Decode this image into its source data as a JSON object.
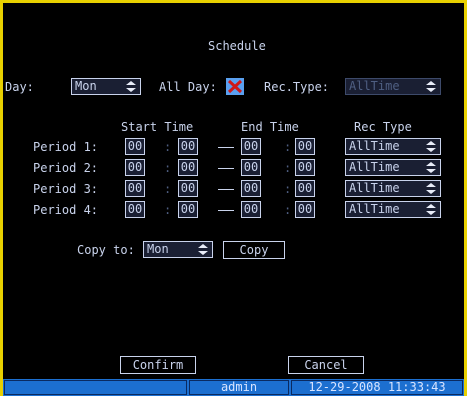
{
  "title": "Schedule",
  "day": {
    "label": "Day:",
    "value": "Mon"
  },
  "all_day": {
    "label": "All Day:",
    "checked": true
  },
  "rec_type": {
    "label": "Rec.Type:",
    "value": "AllTime"
  },
  "headers": {
    "start": "Start Time",
    "end": "End Time",
    "rec": "Rec Type"
  },
  "periods": [
    {
      "label": "Period 1:",
      "start_h": "00",
      "start_m": "00",
      "end_h": "00",
      "end_m": "00",
      "rec": "AllTime"
    },
    {
      "label": "Period 2:",
      "start_h": "00",
      "start_m": "00",
      "end_h": "00",
      "end_m": "00",
      "rec": "AllTime"
    },
    {
      "label": "Period 3:",
      "start_h": "00",
      "start_m": "00",
      "end_h": "00",
      "end_m": "00",
      "rec": "AllTime"
    },
    {
      "label": "Period 4:",
      "start_h": "00",
      "start_m": "00",
      "end_h": "00",
      "end_m": "00",
      "rec": "AllTime"
    }
  ],
  "copy": {
    "label": "Copy to:",
    "value": "Mon",
    "button": "Copy"
  },
  "buttons": {
    "confirm": "Confirm",
    "cancel": "Cancel"
  },
  "status": {
    "user": "admin",
    "datetime": "12-29-2008 11:33:43"
  },
  "colors": {
    "frame": "#e8d000",
    "screen": "#000000",
    "text": "#c9d3ec",
    "status": "#1c6fd0",
    "check": "#d01818"
  }
}
